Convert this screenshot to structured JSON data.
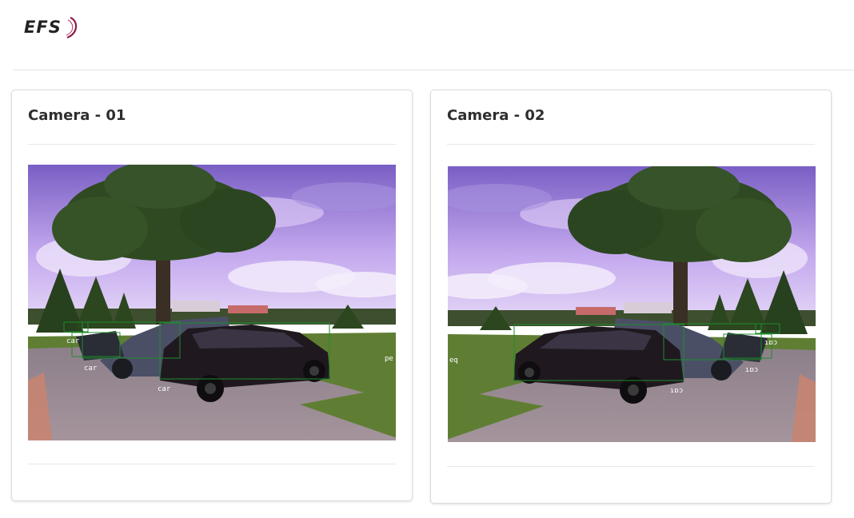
{
  "header": {
    "logo_text": "EFS"
  },
  "cameras": [
    {
      "title": "Camera - 01",
      "detections": [
        "car",
        "car",
        "car",
        "pe"
      ]
    },
    {
      "title": "Camera - 02",
      "detections": [
        "eq",
        "ɿɒɔ",
        "ɿɒɔ",
        "ɿɒɔ"
      ]
    }
  ],
  "colors": {
    "accent_logo": "#8b1a4a",
    "detection_box": "#1c8c2c"
  }
}
